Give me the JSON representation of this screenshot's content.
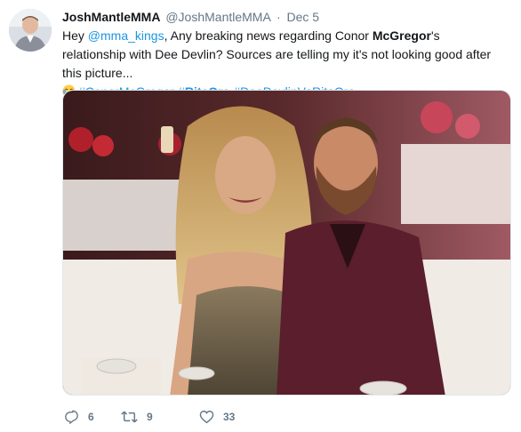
{
  "tweet": {
    "display_name": "JoshMantleMMA",
    "handle": "@JoshMantleMMA",
    "separator": "·",
    "time": "Dec 5",
    "text": {
      "part1": "Hey ",
      "mention": "@mma_kings",
      "part2": ", Any breaking news regarding Conor ",
      "bold_name": "McGregor",
      "part3": "'s relationship with Dee Devlin? Sources are telling my it's not looking good after this picture...",
      "emoji": "laughing-tears-emoji",
      "hashtag1": "#ConorMcGregor",
      "hashtag2_prefix": "#",
      "hashtag2_bold": "RitaOra",
      "hashtag3": "#DeeDevlinVsRitaOra"
    },
    "actions": {
      "replies": "6",
      "retweets": "9",
      "likes": "33"
    }
  },
  "colors": {
    "link": "#1b95e0",
    "muted": "#657786",
    "text": "#14171a"
  }
}
